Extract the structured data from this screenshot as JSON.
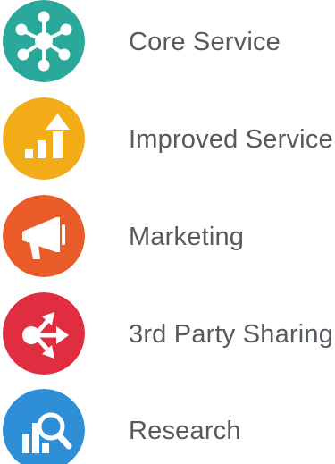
{
  "items": [
    {
      "label": "Core Service",
      "icon": "network-hub-icon",
      "color": "#2aa89a"
    },
    {
      "label": "Improved Service",
      "icon": "growth-chart-icon",
      "color": "#f1ac17"
    },
    {
      "label": "Marketing",
      "icon": "megaphone-icon",
      "color": "#ea5b2a"
    },
    {
      "label": "3rd Party Sharing",
      "icon": "share-arrows-icon",
      "color": "#e02d40"
    },
    {
      "label": "Research",
      "icon": "magnifier-chart-icon",
      "color": "#2f8fd6"
    }
  ]
}
